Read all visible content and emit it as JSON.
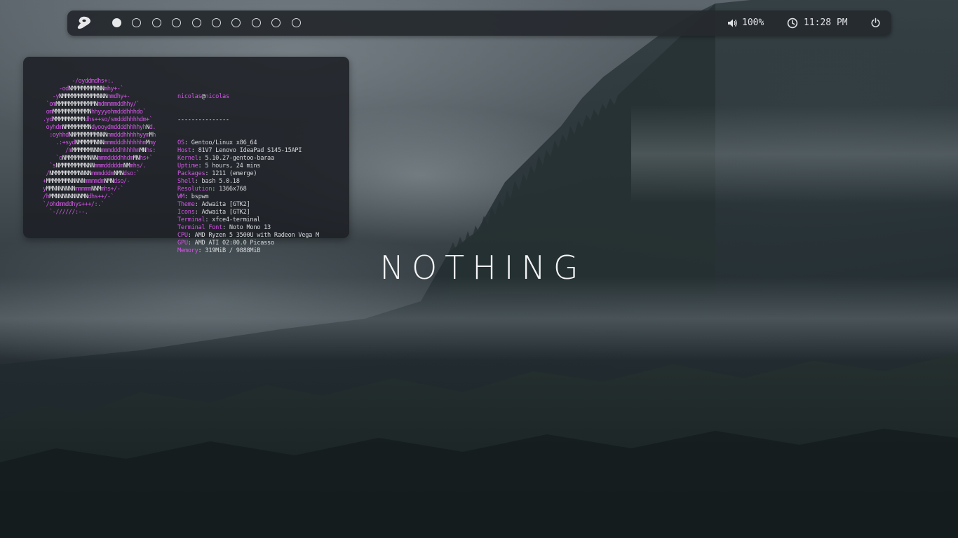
{
  "topbar": {
    "logo_icon": "gentoo-logo-icon",
    "workspaces": [
      {
        "state": "active"
      },
      {
        "state": "empty"
      },
      {
        "state": "empty"
      },
      {
        "state": "empty"
      },
      {
        "state": "empty"
      },
      {
        "state": "empty"
      },
      {
        "state": "empty"
      },
      {
        "state": "empty"
      },
      {
        "state": "empty"
      },
      {
        "state": "empty"
      }
    ],
    "volume_icon": "speaker-icon",
    "volume": "100%",
    "clock_icon": "clock-icon",
    "time": "11:28 PM",
    "power_icon": "power-icon"
  },
  "neofetch": {
    "ascii_art": [
      "         -/oyddmdhs+:.",
      "     -odNMMMMMMMMNNmhy+-`",
      "   -yNMMMMMMMMMMMNNNmmdhy+-",
      " `omMMMMMMMMMMMMNmdmmmmddhhy/`",
      " omMMMMMMMMMMMNhhyyyohmdddhhhdo`",
      ".ydMMMMMMMMMMdhs++so/smdddhhhhdm+`",
      " oyhdmNMMMMMMMNdyooydmddddhhhhyhNd.",
      "  :oyhhdNNMMMMMMMNNNmmdddhhhhhyymMh",
      "    .:+sydNMMMMMNNNmmmdddhhhhhhmMmy",
      "       /mMMMMMMNNNmmmdddhhhhhmMNhs:",
      "    `oNMMMMMMMNNNmmmddddhhdmMNhs+`",
      "  `sNMMMMMMMMNNNmmmdddddmNMmhs/.",
      " /NMMMMMMMMNNNNmmmdddmNMNdso:`",
      "+MMMMMMMNNNNNmmmmdmNMNdso/-",
      "yMMNNNNNNNmmmmmNNMmhs+/-`",
      "/hMMNNNNNNNNMNdhs++/-`",
      "`/ohdmmddhys+++/:.`",
      "  `-//////:--."
    ],
    "user": "nicolas",
    "host": "nicolas",
    "separator": "---------------",
    "fields": [
      {
        "key": "OS",
        "value": "Gentoo/Linux x86_64"
      },
      {
        "key": "Host",
        "value": "81V7 Lenovo IdeaPad S145-15API"
      },
      {
        "key": "Kernel",
        "value": "5.10.27-gentoo-baraa"
      },
      {
        "key": "Uptime",
        "value": "5 hours, 24 mins"
      },
      {
        "key": "Packages",
        "value": "1211 (emerge)"
      },
      {
        "key": "Shell",
        "value": "bash 5.0.18"
      },
      {
        "key": "Resolution",
        "value": "1366x768"
      },
      {
        "key": "WM",
        "value": "bspwm"
      },
      {
        "key": "Theme",
        "value": "Adwaita [GTK2]"
      },
      {
        "key": "Icons",
        "value": "Adwaita [GTK2]"
      },
      {
        "key": "Terminal",
        "value": "xfce4-terminal"
      },
      {
        "key": "Terminal Font",
        "value": "Noto Mono 13"
      },
      {
        "key": "CPU",
        "value": "AMD Ryzen 5 3500U with Radeon Vega M"
      },
      {
        "key": "GPU",
        "value": "AMD ATI 02:00.0 Picasso"
      },
      {
        "key": "Memory",
        "value": "319MiB / 9888MiB"
      }
    ]
  },
  "wallpaper": {
    "title": "NOTHING"
  },
  "colors": {
    "accent": "#d255e6",
    "bar_bg": "#26292f",
    "terminal_bg": "#1c1f24",
    "text": "#e0e2e4"
  }
}
